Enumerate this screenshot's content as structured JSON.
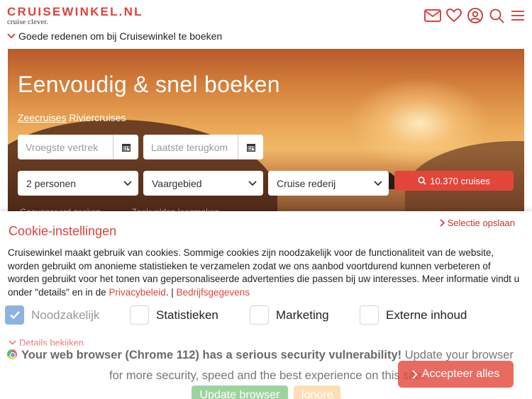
{
  "header": {
    "logo_main": "CRUISEWINKEL.NL",
    "logo_sub": "cruise clever.",
    "reasons": "Goede redenen om bij Cruisewinkel te boeken",
    "icons": [
      "mail-icon",
      "heart-icon",
      "user-icon",
      "search-icon",
      "menu-icon"
    ]
  },
  "hero": {
    "title": "Eenvoudig & snel boeken",
    "tab_sea": "Zeecruises",
    "tab_river": "Riviercruises",
    "departure_placeholder": "Vroegste vertrek",
    "return_placeholder": "Laatste terugkom",
    "persons": "2 personen",
    "region": "Vaargebied",
    "line": "Cruise rederij",
    "search_label": "10.370 cruises",
    "strip_left": "Geavanceerd zoeken",
    "strip_right": "Zoekvelden leegmaken"
  },
  "cookie": {
    "title": "Cookie-instellingen",
    "save_selection": "Selectie opslaan",
    "text": "Cruisewinkel maakt gebruik van cookies. Sommige cookies zijn noodzakelijk voor de functionaliteit van de website, worden gebruikt om anonieme statistieken te verzamelen zodat we ons aanbod voortdurend kunnen verbeteren of worden gebruikt voor het tonen van gepersonaliseerde advertenties die passen bij uw interesses. Meer informatie vindt u onder \"details\" en in de ",
    "privacy": "Privacybeleid",
    "sep": ". | ",
    "company": "Bedrijfsgegevens",
    "options": {
      "necessary": "Noodzakelijk",
      "statistics": "Statistieken",
      "marketing": "Marketing",
      "external": "Externe inhoud"
    },
    "details": "Details bekijken",
    "accept": "Accepteer alles"
  },
  "browser_warning": {
    "bold": "Your web browser (Chrome 112) has a serious security vulnerability!",
    "rest1": " Update your browser",
    "line2": "for more security, speed and the best experience on this site.",
    "update": "Update browser",
    "ignore": "Ignore"
  },
  "colors": {
    "brand": "#e0433a",
    "accept": "#e2463b",
    "checked": "#8fb3e0"
  }
}
